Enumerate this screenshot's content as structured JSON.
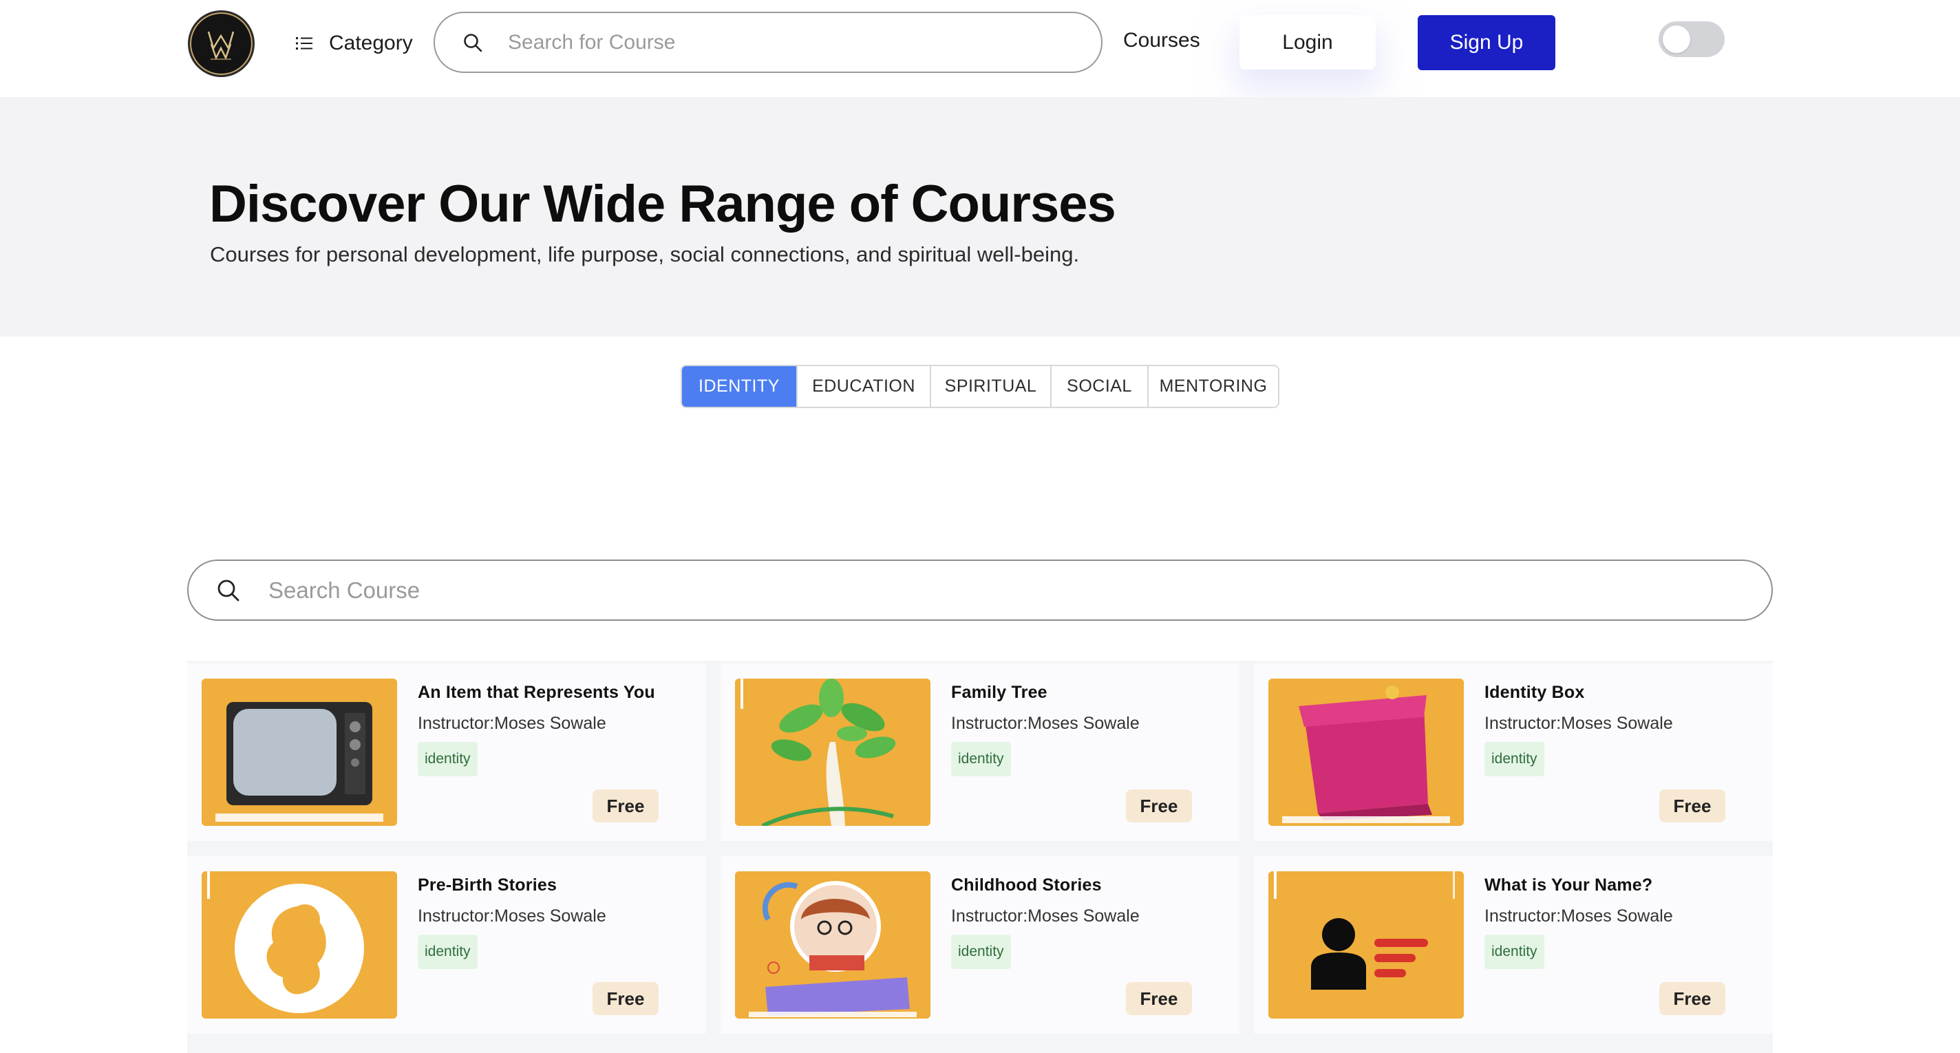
{
  "navbar": {
    "category_label": "Category",
    "search_placeholder": "Search for Course",
    "courses_label": "Courses",
    "login_label": "Login",
    "signup_label": "Sign Up"
  },
  "hero": {
    "title": "Discover Our Wide Range of Courses",
    "subtitle": "Courses for personal development, life purpose, social connections, and spiritual well-being."
  },
  "tabs": [
    {
      "label": "IDENTITY",
      "active": true
    },
    {
      "label": "EDUCATION",
      "active": false
    },
    {
      "label": "SPIRITUAL",
      "active": false
    },
    {
      "label": "SOCIAL",
      "active": false
    },
    {
      "label": "MENTORING",
      "active": false
    }
  ],
  "course_search": {
    "placeholder": "Search Course"
  },
  "courses": [
    {
      "title": "An Item that Represents You",
      "instructor": "Instructor:Moses Sowale",
      "tag": "identity",
      "price": "Free",
      "image": "television-image"
    },
    {
      "title": "Family Tree",
      "instructor": "Instructor:Moses Sowale",
      "tag": "identity",
      "price": "Free",
      "image": "tree-image"
    },
    {
      "title": "Identity Box",
      "instructor": "Instructor:Moses Sowale",
      "tag": "identity",
      "price": "Free",
      "image": "gift-box-image"
    },
    {
      "title": "Pre-Birth Stories",
      "instructor": "Instructor:Moses Sowale",
      "tag": "identity",
      "price": "Free",
      "image": "fetus-image"
    },
    {
      "title": "Childhood Stories",
      "instructor": "Instructor:Moses Sowale",
      "tag": "identity",
      "price": "Free",
      "image": "child-reading-image"
    },
    {
      "title": "What is Your Name?",
      "instructor": "Instructor:Moses Sowale",
      "tag": "identity",
      "price": "Free",
      "image": "person-name-image"
    }
  ],
  "colors": {
    "accent": "#1a20c4",
    "tab_active": "#4c7ef2",
    "thumb_bg": "#f0ae3c",
    "tag_bg": "#e4f5e6",
    "price_bg": "#f7e8d3"
  }
}
